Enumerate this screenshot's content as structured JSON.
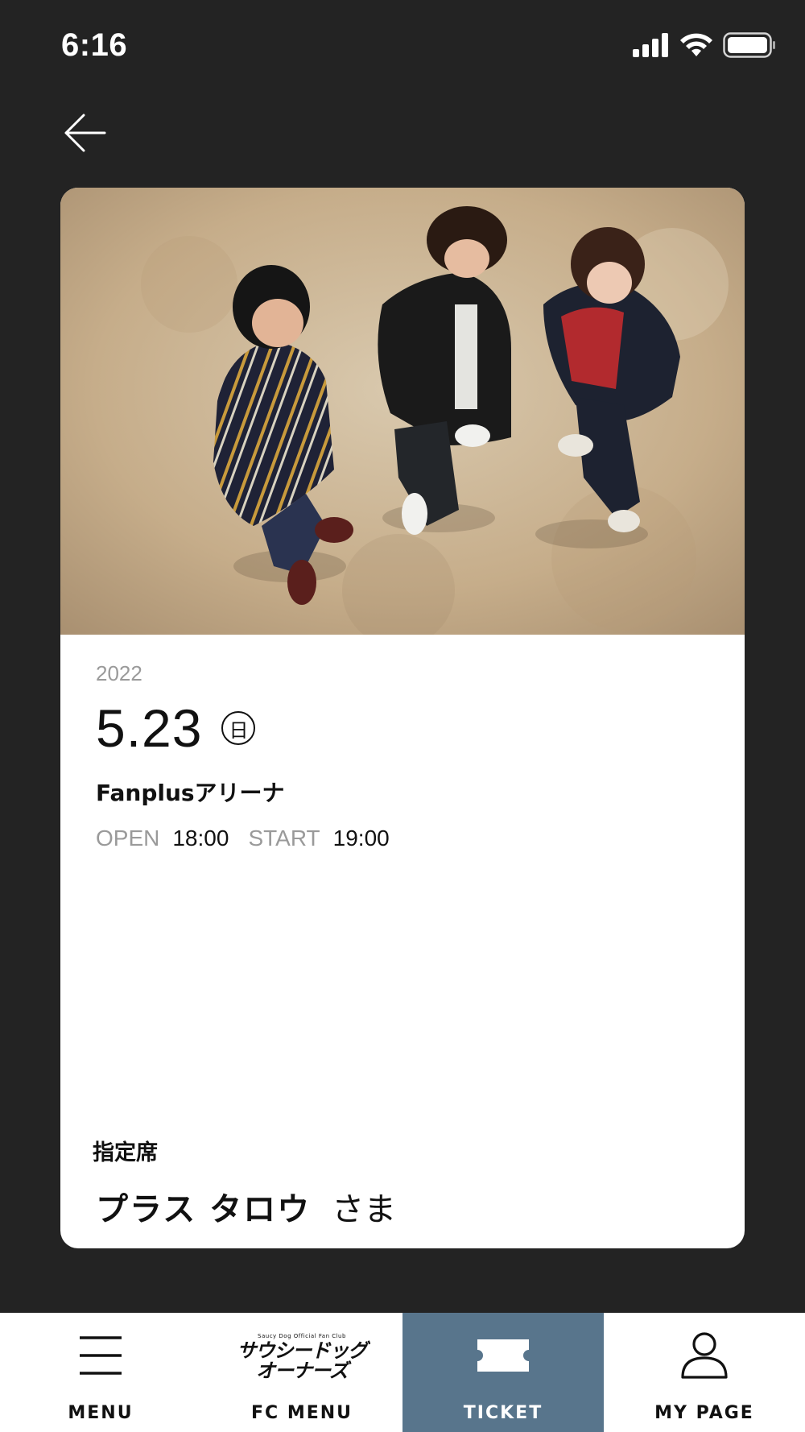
{
  "status_bar": {
    "time": "6:16",
    "icons": [
      "cellular-signal-icon",
      "wifi-icon",
      "battery-icon"
    ]
  },
  "header": {
    "back_icon": "arrow-left-icon"
  },
  "ticket": {
    "year": "2022",
    "date": "5.23",
    "weekday": "日",
    "venue": "Fanplusアリーナ",
    "open_label": "OPEN",
    "open_time": "18:00",
    "start_label": "START",
    "start_time": "19:00",
    "seat_type": "指定席",
    "holder_name": "プラス タロウ",
    "holder_suffix": "さま"
  },
  "bottom_nav": {
    "items": [
      {
        "label": "MENU",
        "icon": "hamburger-menu-icon",
        "active": false
      },
      {
        "label": "FC MENU",
        "icon": "fan-club-logo",
        "active": false
      },
      {
        "label": "TICKET",
        "icon": "ticket-icon",
        "active": true
      },
      {
        "label": "MY PAGE",
        "icon": "user-icon",
        "active": false
      }
    ],
    "fc_logo_small": "Saucy Dog Official Fan Club",
    "fc_logo_line1": "サウシードッグ",
    "fc_logo_line2": "オーナーズ"
  },
  "colors": {
    "background": "#232323",
    "card": "#ffffff",
    "active_tab": "#58758c",
    "muted_text": "#9a9a9a"
  }
}
